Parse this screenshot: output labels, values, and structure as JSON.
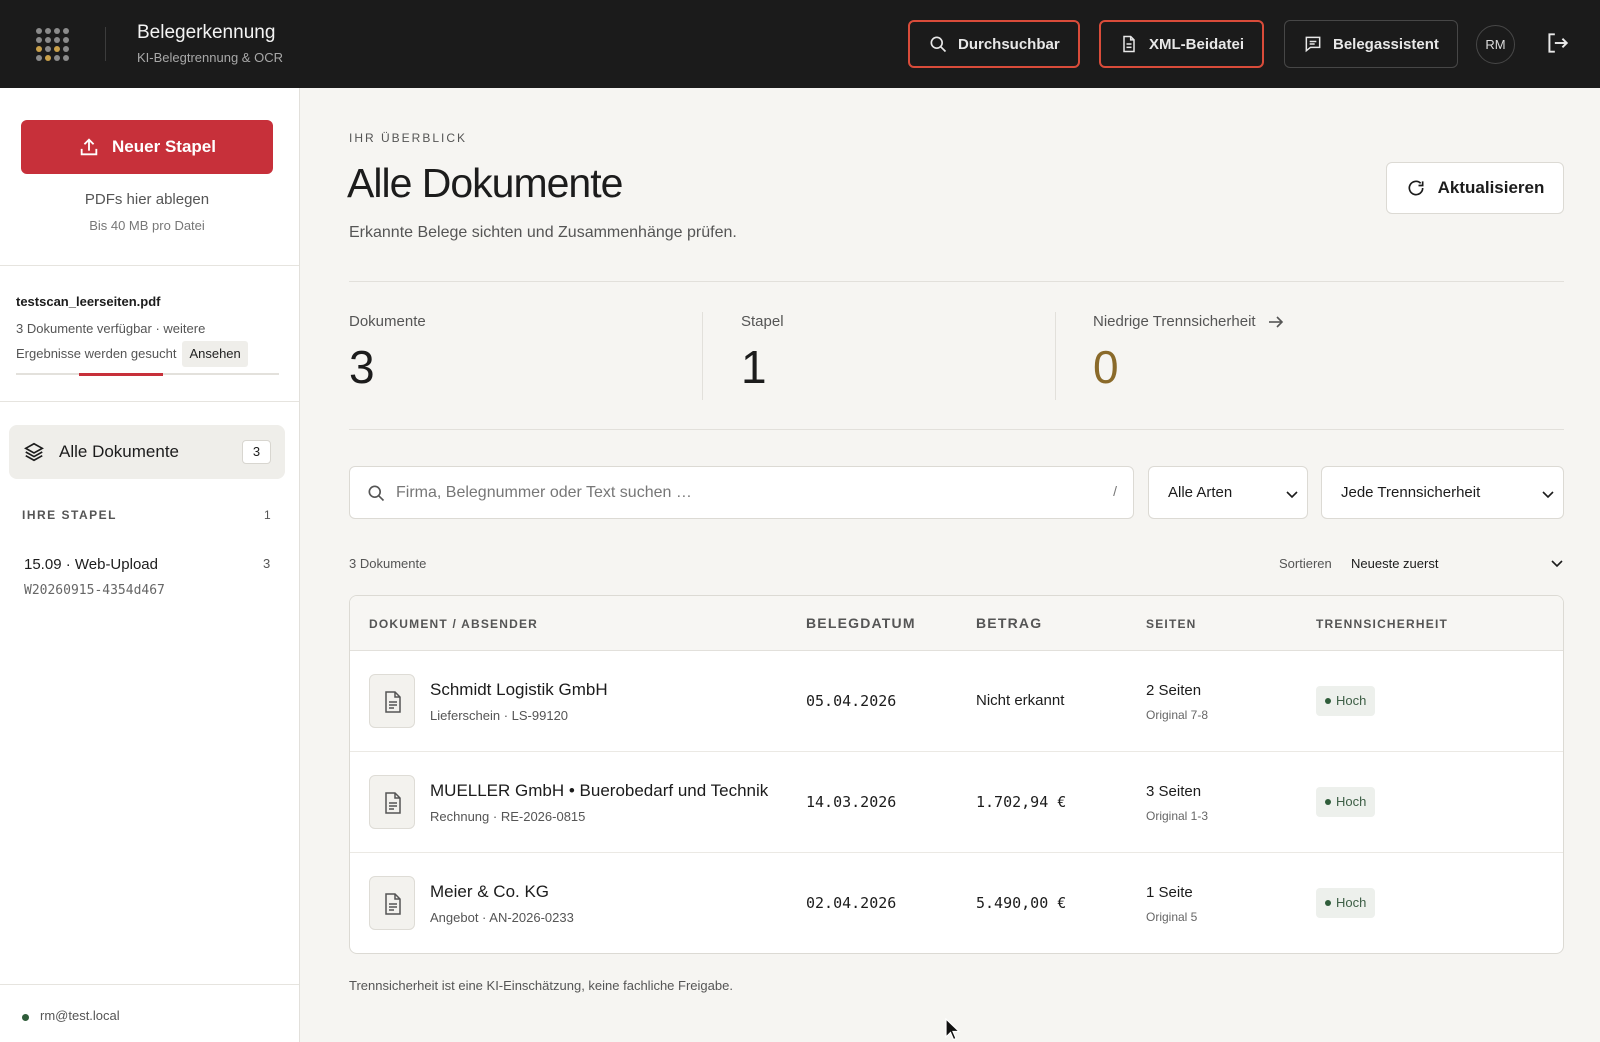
{
  "header": {
    "title": "Belegerkennung",
    "subtitle": "KI-Belegtrennung & OCR",
    "buttons": [
      "Durchsuchbar",
      "XML-Beidatei",
      "Belegassistent"
    ],
    "avatar": "RM"
  },
  "sidebar": {
    "new_button": "Neuer Stapel",
    "drop_hint": "PDFs hier ablegen",
    "drop_limit": "Bis 40 MB pro Datei",
    "upload": {
      "file": "testscan_leerseiten.pdf",
      "status": "3 Dokumente verfügbar · weitere Ergebnisse werden gesucht",
      "view_label": "Ansehen"
    },
    "nav_all": {
      "label": "Alle Dokumente",
      "count": "3"
    },
    "stacks_heading": "IHRE STAPEL",
    "stacks_count": "1",
    "stack": {
      "name": "15.09 · Web-Upload",
      "count": "3",
      "id": "W20260915-4354d467"
    },
    "user_email": "rm@test.local"
  },
  "main": {
    "eyebrow": "IHR ÜBERBLICK",
    "title": "Alle Dokumente",
    "subtitle": "Erkannte Belege sichten und Zusammenhänge prüfen.",
    "refresh_label": "Aktualisieren",
    "stats": [
      {
        "label": "Dokumente",
        "value": "3"
      },
      {
        "label": "Stapel",
        "value": "1"
      },
      {
        "label": "Niedrige Trennsicherheit",
        "value": "0"
      }
    ],
    "search_placeholder": "Firma, Belegnummer oder Text suchen …",
    "search_shortcut": "/",
    "filter_type": "Alle Arten",
    "filter_confidence": "Jede Trennsicherheit",
    "doc_count": "3 Dokumente",
    "sort_label": "Sortieren",
    "sort_value": "Neueste zuerst",
    "columns": [
      "DOKUMENT / ABSENDER",
      "BELEGDATUM",
      "BETRAG",
      "SEITEN",
      "TRENNSICHERHEIT"
    ],
    "rows": [
      {
        "sender": "Schmidt Logistik GmbH",
        "meta": "Lieferschein · LS-99120",
        "date": "05.04.2026",
        "amount": "Nicht erkannt",
        "pages": "2 Seiten",
        "original": "Original 7-8",
        "confidence": "Hoch"
      },
      {
        "sender": "MUELLER GmbH • Buerobedarf und Technik",
        "meta": "Rechnung · RE-2026-0815",
        "date": "14.03.2026",
        "amount": "1.702,94 €",
        "pages": "3 Seiten",
        "original": "Original 1-3",
        "confidence": "Hoch"
      },
      {
        "sender": "Meier & Co. KG",
        "meta": "Angebot · AN-2026-0233",
        "date": "02.04.2026",
        "amount": "5.490,00 €",
        "pages": "1 Seite",
        "original": "Original 5",
        "confidence": "Hoch"
      }
    ],
    "footnote": "Trennsicherheit ist eine KI-Einschätzung, keine fachliche Freigabe."
  },
  "colors": {
    "accent": "#c7303a",
    "highlight_border": "#d94c3a",
    "topbar": "#1b1b1b",
    "success": "#2f5d3a",
    "warning": "#8a6a2a"
  }
}
